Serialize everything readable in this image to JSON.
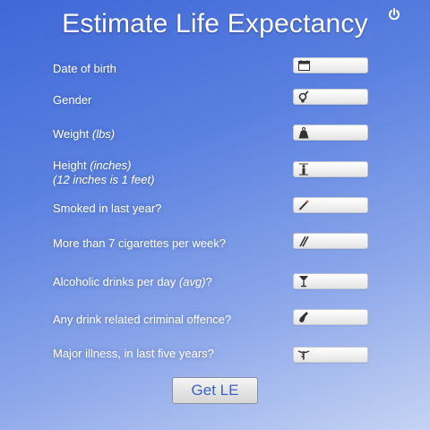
{
  "app": {
    "title": "Estimate Life Expectancy"
  },
  "icons": {
    "power": "power-icon",
    "calendar": "calendar-icon",
    "gender": "gender-icon",
    "weight": "weight-icon",
    "height": "height-icon",
    "smoking": "cigarette-icon",
    "cigarettes": "cigarettes-icon",
    "alcohol": "alcohol-glass-icon",
    "offence": "bottle-icon",
    "illness": "caduceus-icon"
  },
  "form": {
    "dob": {
      "label": "Date of birth",
      "value": ""
    },
    "gender": {
      "label": "Gender",
      "value": ""
    },
    "weight": {
      "label": "Weight",
      "unit": "(lbs)",
      "value": ""
    },
    "height": {
      "label": "Height",
      "unit": "(inches)",
      "note": "(12 inches is 1 feet)",
      "value": ""
    },
    "smoked": {
      "label": "Smoked in last year?",
      "value": ""
    },
    "cigarettes": {
      "label": "More than 7 cigarettes per week?",
      "value": ""
    },
    "alcohol": {
      "label_pre": "Alcoholic drinks per day",
      "unit": "(avg)",
      "label_post": "?",
      "value": ""
    },
    "offence": {
      "label": "Any drink related criminal offence?",
      "value": ""
    },
    "illness": {
      "label": "Major illness, in last five years?",
      "value": ""
    }
  },
  "actions": {
    "get_le": "Get LE"
  },
  "colors": {
    "accent": "#3a62c9",
    "background_top": "#3f68d8",
    "background_bottom": "#c5d3f3"
  }
}
